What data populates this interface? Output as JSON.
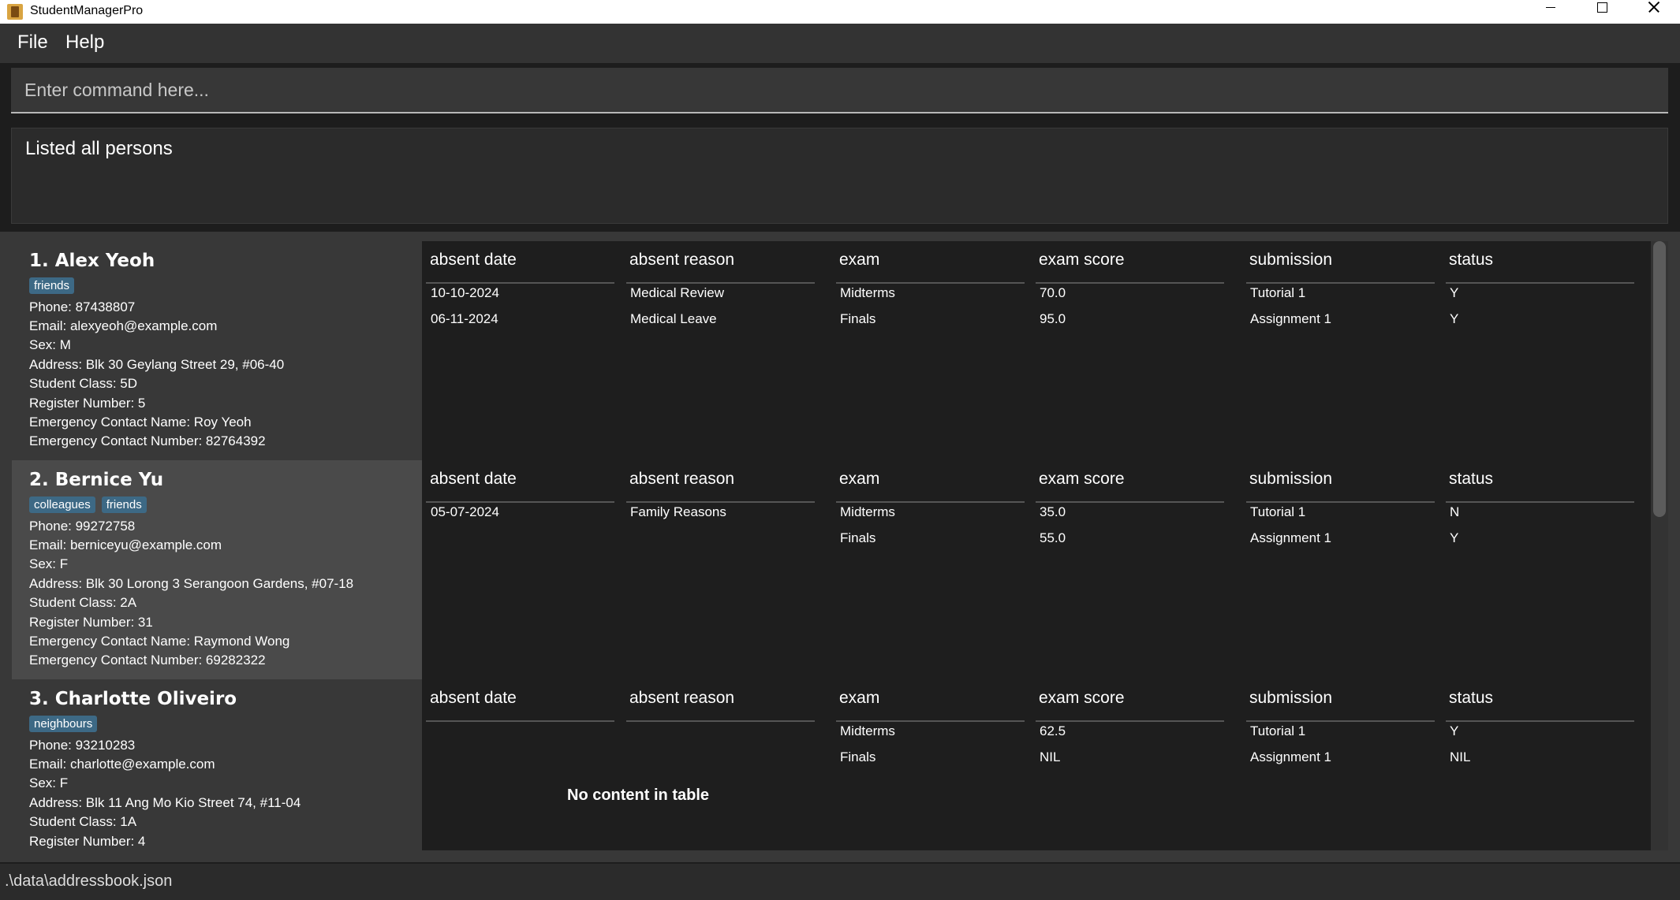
{
  "window": {
    "title": "StudentManagerPro"
  },
  "menu": {
    "file": "File",
    "help": "Help"
  },
  "command": {
    "placeholder": "Enter command here..."
  },
  "result": {
    "text": "Listed all persons"
  },
  "table_headers": {
    "absent_date": "absent date",
    "absent_reason": "absent reason",
    "exam": "exam",
    "exam_score": "exam score",
    "submission": "submission",
    "status": "status"
  },
  "persons": [
    {
      "name": "1. Alex Yeoh",
      "tags": [
        "friends"
      ],
      "phone": "Phone: 87438807",
      "email": "Email: alexyeoh@example.com",
      "sex": "Sex: M",
      "address": "Address: Blk 30 Geylang Street 29, #06-40",
      "student_class": "Student Class: 5D",
      "register_number": "Register Number: 5",
      "emergency_name": "Emergency Contact Name: Roy Yeoh",
      "emergency_number": "Emergency Contact Number: 82764392",
      "attendance": [
        {
          "date": "10-10-2024",
          "reason": "Medical Review"
        },
        {
          "date": "06-11-2024",
          "reason": "Medical Leave"
        }
      ],
      "exams": [
        {
          "exam": "Midterms",
          "score": "70.0"
        },
        {
          "exam": "Finals",
          "score": "95.0"
        }
      ],
      "submissions": [
        {
          "submission": "Tutorial 1",
          "status": "Y"
        },
        {
          "submission": "Assignment 1",
          "status": "Y"
        }
      ]
    },
    {
      "name": "2. Bernice Yu",
      "tags": [
        "colleagues",
        "friends"
      ],
      "phone": "Phone: 99272758",
      "email": "Email: berniceyu@example.com",
      "sex": "Sex: F",
      "address": "Address: Blk 30 Lorong 3 Serangoon Gardens, #07-18",
      "student_class": "Student Class: 2A",
      "register_number": "Register Number: 31",
      "emergency_name": "Emergency Contact Name: Raymond Wong",
      "emergency_number": "Emergency Contact Number: 69282322",
      "attendance": [
        {
          "date": "05-07-2024",
          "reason": "Family Reasons"
        }
      ],
      "exams": [
        {
          "exam": "Midterms",
          "score": "35.0"
        },
        {
          "exam": "Finals",
          "score": "55.0"
        }
      ],
      "submissions": [
        {
          "submission": "Tutorial 1",
          "status": "N"
        },
        {
          "submission": "Assignment 1",
          "status": "Y"
        }
      ]
    },
    {
      "name": "3. Charlotte Oliveiro",
      "tags": [
        "neighbours"
      ],
      "phone": "Phone: 93210283",
      "email": "Email: charlotte@example.com",
      "sex": "Sex: F",
      "address": "Address: Blk 11 Ang Mo Kio Street 74, #11-04",
      "student_class": "Student Class: 1A",
      "register_number": "Register Number: 4",
      "attendance_empty": "No content in table",
      "exams": [
        {
          "exam": "Midterms",
          "score": "62.5"
        },
        {
          "exam": "Finals",
          "score": "NIL"
        }
      ],
      "submissions": [
        {
          "submission": "Tutorial 1",
          "status": "Y"
        },
        {
          "submission": "Assignment 1",
          "status": "NIL"
        }
      ]
    }
  ],
  "status_bar": {
    "path": ".\\data\\addressbook.json"
  }
}
